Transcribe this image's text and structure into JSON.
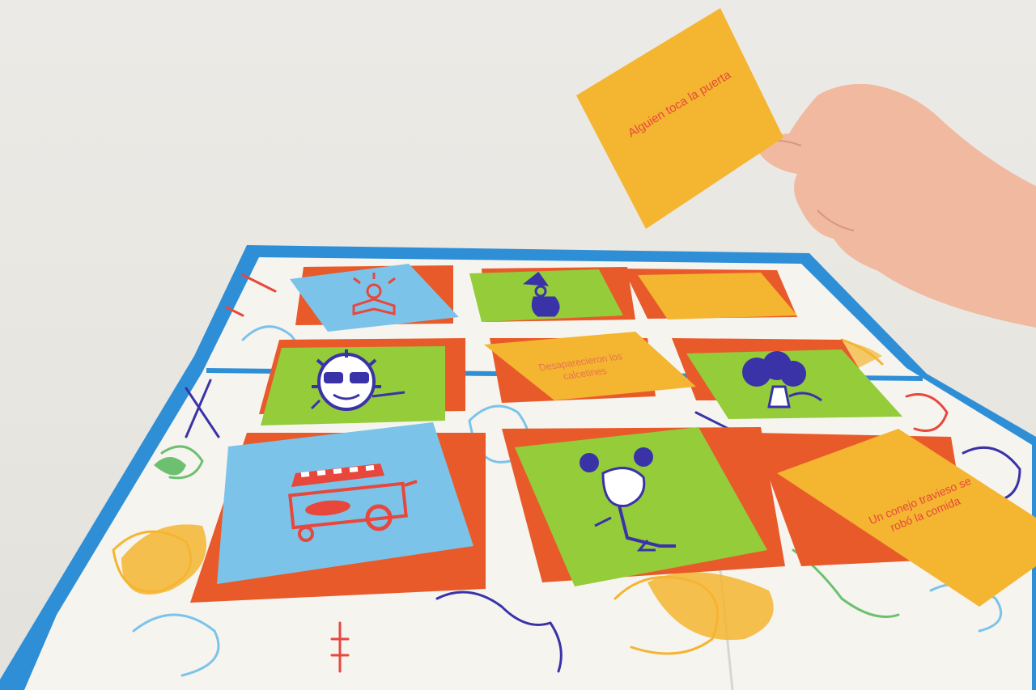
{
  "scene": {
    "description_label": "",
    "colors": {
      "board_blue": "#2f8fd6",
      "board_white": "#f6f4ef",
      "square_orange": "#e95a2b",
      "card_yellow": "#f4b531",
      "card_green": "#94cc3a",
      "card_blue": "#7cc3ea",
      "ink_purple": "#3a33a8",
      "text_red": "#e8473c"
    }
  },
  "held_card": {
    "text": "Alguien toca la puerta"
  },
  "board_cards": [
    {
      "kind": "yellow",
      "text": "Desaparecieron los calcetines"
    },
    {
      "kind": "yellow",
      "text": "Un conejo travieso se robó la comida"
    },
    {
      "kind": "yellow",
      "text": ""
    }
  ],
  "picture_cards": [
    {
      "kind": "blue",
      "icon": "open-book-icon"
    },
    {
      "kind": "green",
      "icon": "witch-icon"
    },
    {
      "kind": "green",
      "icon": "sun-with-glasses-icon"
    },
    {
      "kind": "green",
      "icon": "tree-character-icon"
    },
    {
      "kind": "blue",
      "icon": "hot-dog-cart-icon"
    },
    {
      "kind": "green",
      "icon": "angry-character-icon"
    }
  ]
}
